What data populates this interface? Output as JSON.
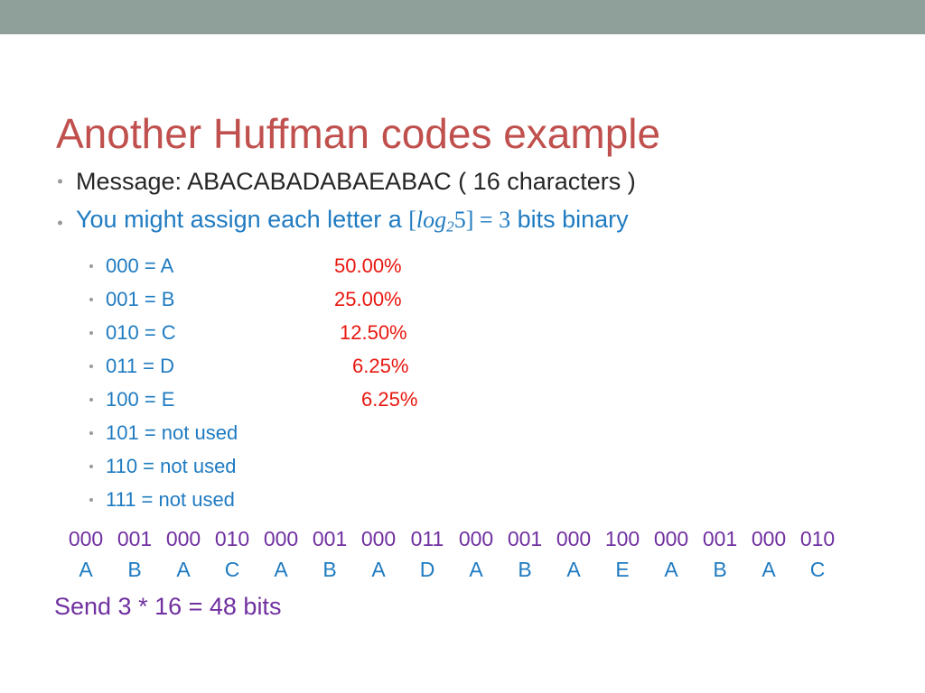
{
  "slide": {
    "title": "Another Huffman codes example",
    "title_color": "#C0504D",
    "band_color": "#8FA09A",
    "background": "#FFFFFF"
  },
  "bullets": [
    {
      "text": "Message: ABACABADABAEABAC ( 16 characters )",
      "color": "#262626",
      "bullet_glyph": "bullet-dot"
    },
    {
      "prefix": "You might assign each letter a ",
      "math_open": "[",
      "math_log": "log",
      "math_sub": "2",
      "math_arg": "5",
      "math_close": "]",
      "math_eq": "=",
      "math_val": "3",
      "suffix": " bits binary",
      "color": "#1F7BC1",
      "bullet_glyph": "bullet-dot"
    }
  ],
  "code_table": {
    "text_color": "#1F7BC1",
    "pct_color": "#E8170F",
    "rows": [
      {
        "code": "000",
        "eq": "=",
        "value": "A",
        "pct": "50.00%",
        "pct_left": 370
      },
      {
        "code": "001",
        "eq": "=",
        "value": "B",
        "pct": "25.00%",
        "pct_left": 370
      },
      {
        "code": "010",
        "eq": "=",
        "value": "C",
        "pct": "12.50%",
        "pct_left": 376
      },
      {
        "code": "011",
        "eq": "=",
        "value": "D",
        "pct": "6.25%",
        "pct_left": 390
      },
      {
        "code": "100",
        "eq": "=",
        "value": "E",
        "pct": "6.25%",
        "pct_left": 400
      },
      {
        "code": "101",
        "eq": "=",
        "value": "not used",
        "pct": "",
        "pct_left": 0
      },
      {
        "code": "110",
        "eq": "=",
        "value": "not used",
        "pct": "",
        "pct_left": 0
      },
      {
        "code": "111",
        "eq": "=",
        "value": "not used",
        "pct": "",
        "pct_left": 0
      }
    ]
  },
  "encoded_stream": {
    "bits_color": "#7030A0",
    "letters_color": "#1F7BC1",
    "bits": [
      "000",
      "001",
      "000",
      "010",
      "000",
      "001",
      "000",
      "011",
      "000",
      "001",
      "000",
      "100",
      "000",
      "001",
      "000",
      "010"
    ],
    "letters": [
      "A",
      "B",
      "A",
      "C",
      "A",
      "B",
      "A",
      "D",
      "A",
      "B",
      "A",
      "E",
      "A",
      "B",
      "A",
      "C"
    ]
  },
  "footer": {
    "send_line": "Send 3 * 16 = 48 bits",
    "color": "#7030A0"
  }
}
